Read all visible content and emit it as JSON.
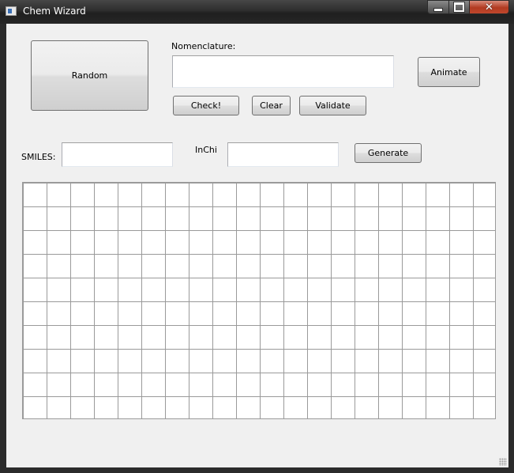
{
  "window": {
    "title": "Chem Wizard",
    "close_glyph": "✕"
  },
  "toolbar": {
    "random_label": "Random",
    "nomenclature_label": "Nomenclature:",
    "animate_label": "Animate",
    "check_label": "Check!",
    "clear_label": "Clear",
    "validate_label": "Validate"
  },
  "inputs": {
    "nomenclature_value": "",
    "smiles_label": "SMILES:",
    "smiles_value": "",
    "inchi_label": "InChi",
    "inchi_value": "",
    "generate_label": "Generate"
  },
  "canvas": {
    "type": "grid",
    "columns": 20,
    "rows": 10
  },
  "icons": [
    "app-icon",
    "minimize-icon",
    "maximize-icon",
    "close-icon",
    "resize-grip-icon"
  ]
}
